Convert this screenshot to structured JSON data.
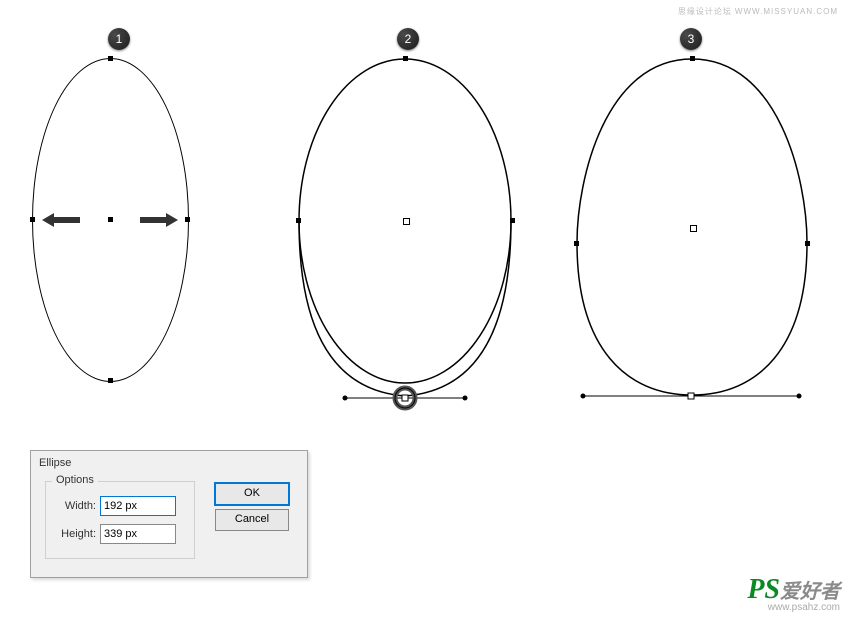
{
  "watermark_top": "思缘设计论坛",
  "watermark_top_url": "WWW.MISSYUAN.COM",
  "watermark_ps": "PS",
  "watermark_cn": "爱好者",
  "watermark_url": "www.psahz.com",
  "badge1": "1",
  "badge2": "2",
  "badge3": "3",
  "dialog": {
    "title": "Ellipse",
    "options_legend": "Options",
    "width_label": "Width:",
    "width_value": "192 px",
    "height_label": "Height:",
    "height_value": "339 px",
    "ok": "OK",
    "cancel": "Cancel"
  }
}
